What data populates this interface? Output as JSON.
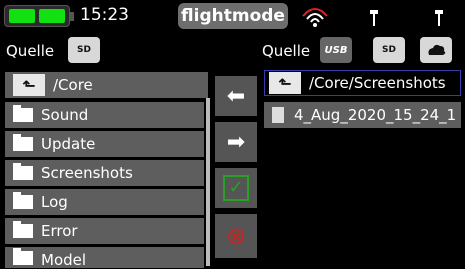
{
  "status": {
    "time": "15:23",
    "mode": "flightmode"
  },
  "left_panel": {
    "source_label": "Quelle",
    "source_icon": "sd-card-icon",
    "source_chip": "SD",
    "path": "/Core",
    "items": [
      "Sound",
      "Update",
      "Screenshots",
      "Log",
      "Error",
      "Model"
    ]
  },
  "right_panel": {
    "source_label": "Quelle",
    "source_chip_usb": "USB",
    "source_chip_sd": "SD",
    "path": "/Core/Screenshots",
    "files": [
      "4_Aug_2020_15_24_1"
    ]
  },
  "actions": {
    "copy_left": "⬅",
    "copy_right": "➡",
    "confirm": "✓",
    "delete": "⊗"
  },
  "colors": {
    "battery": "#11e011",
    "confirm": "#28a028",
    "delete": "#d02020"
  }
}
